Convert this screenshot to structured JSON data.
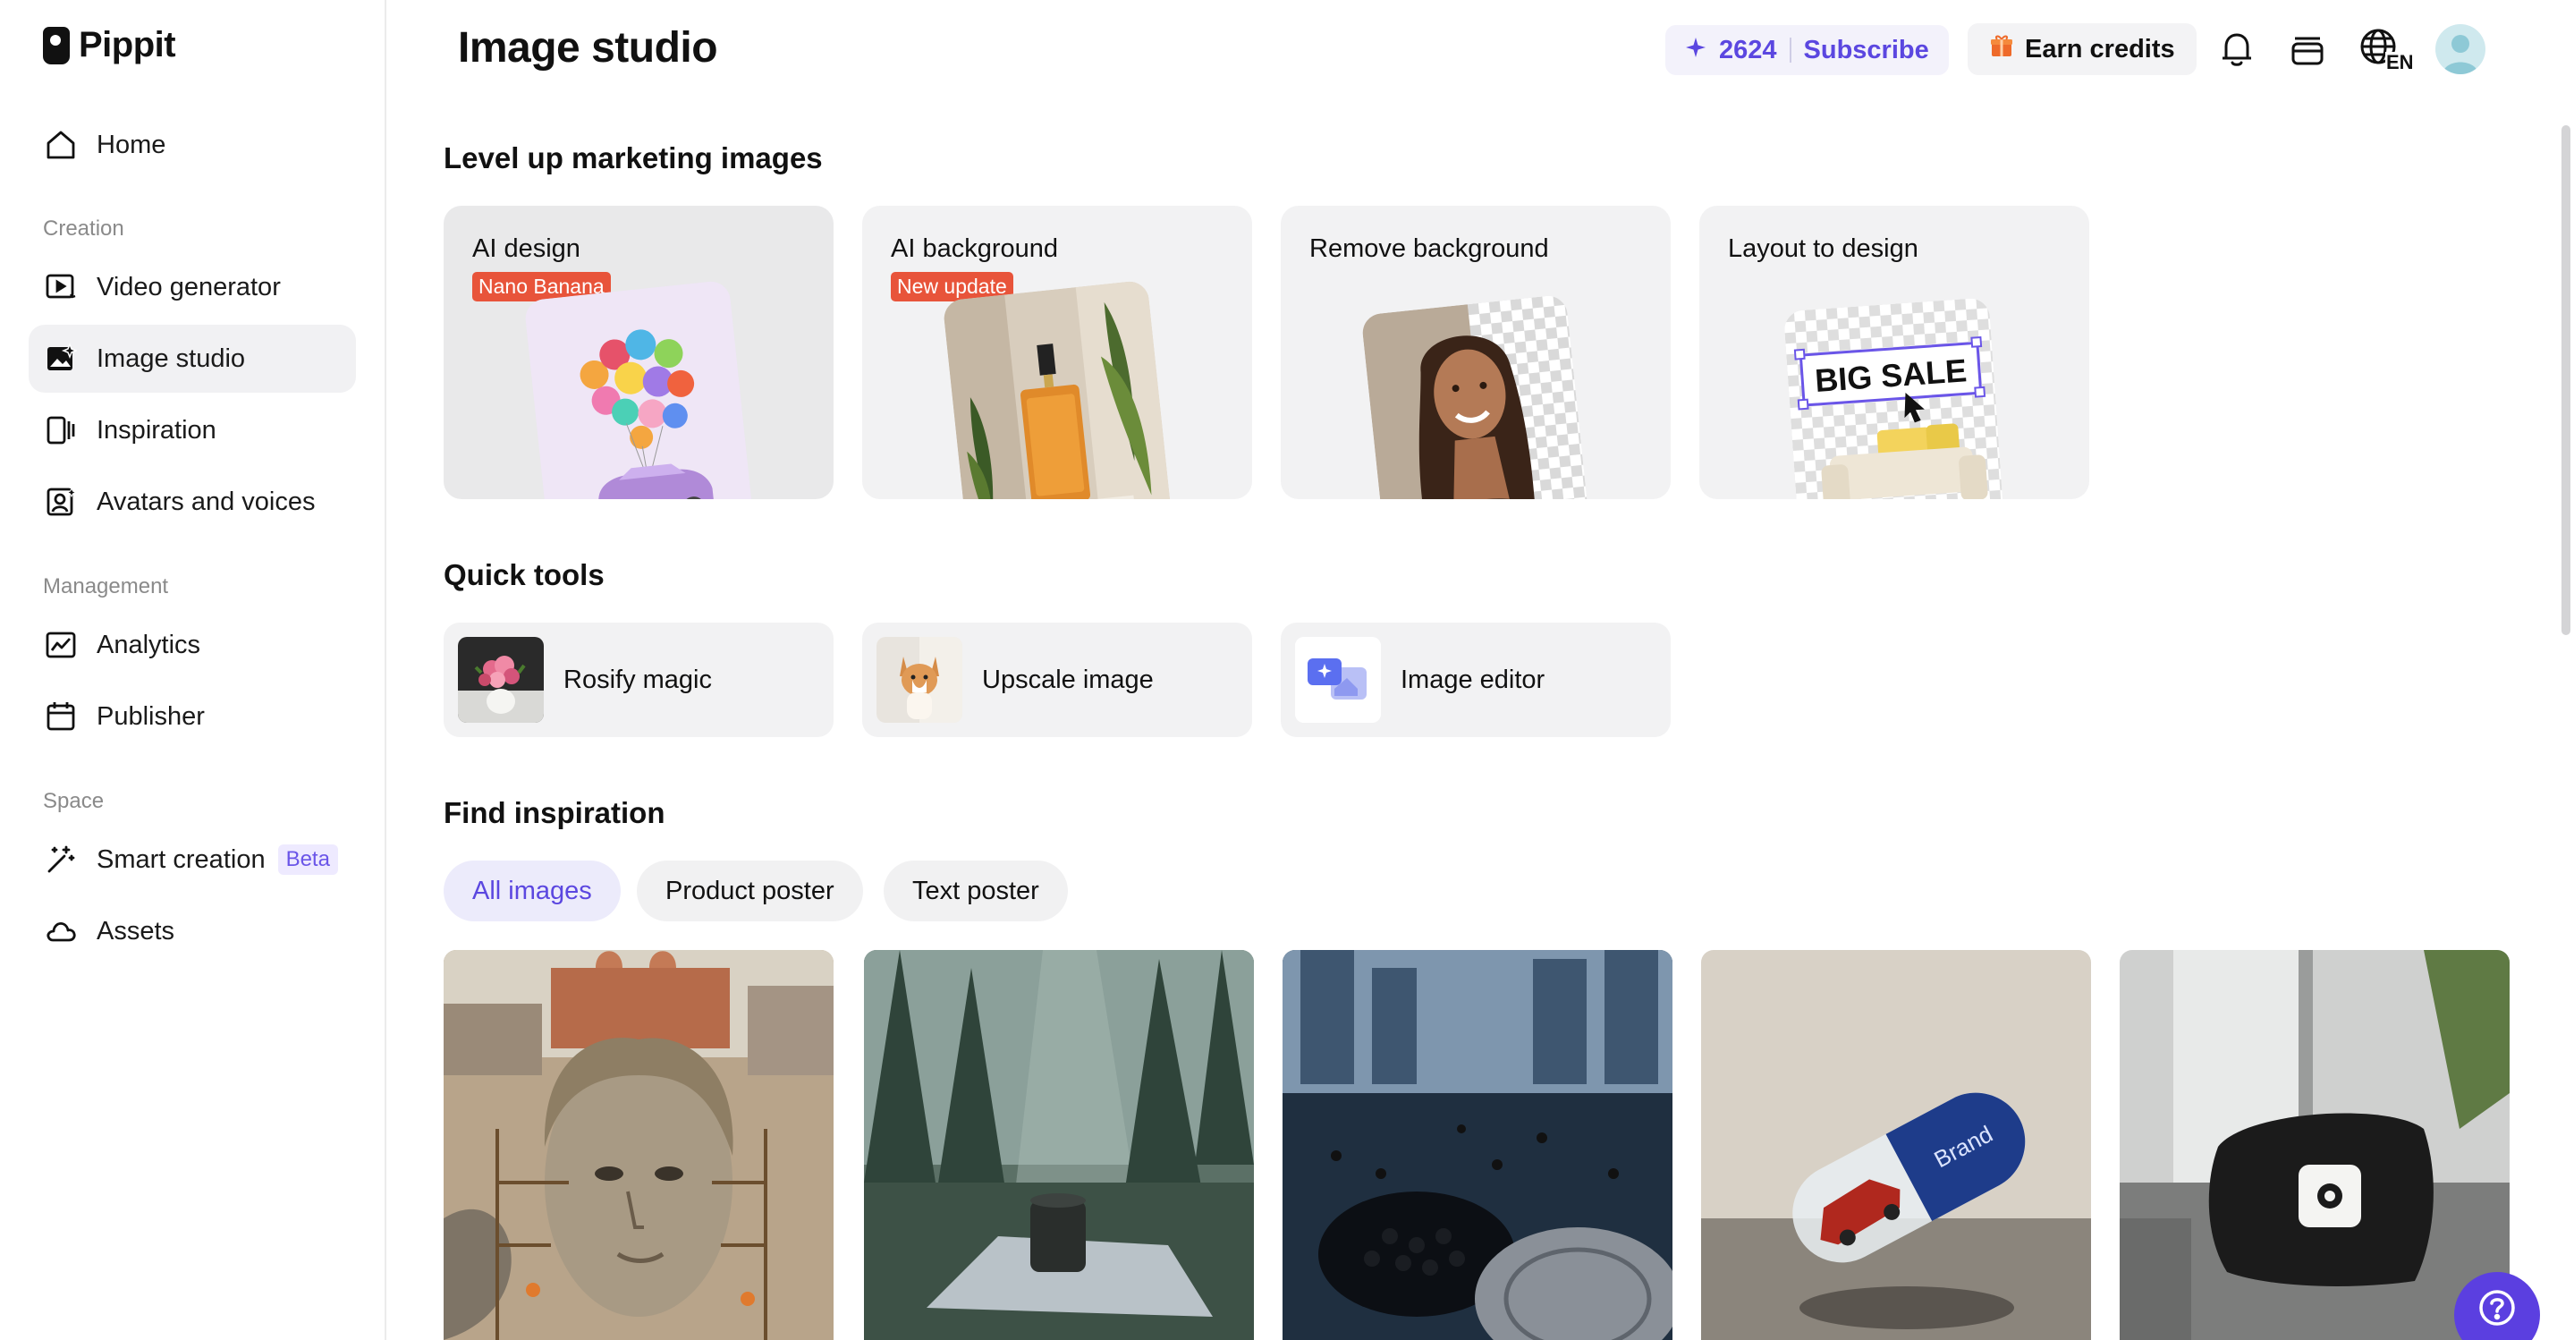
{
  "app": {
    "logo_text": "Pippit"
  },
  "sidebar": {
    "home": "Home",
    "sections": {
      "creation": "Creation",
      "management": "Management",
      "space": "Space"
    },
    "creation_items": [
      {
        "label": "Video generator",
        "icon": "video-play-icon"
      },
      {
        "label": "Image studio",
        "icon": "image-sparkle-icon",
        "active": true
      },
      {
        "label": "Inspiration",
        "icon": "inspiration-icon"
      },
      {
        "label": "Avatars and voices",
        "icon": "avatar-icon"
      }
    ],
    "management_items": [
      {
        "label": "Analytics",
        "icon": "chart-icon"
      },
      {
        "label": "Publisher",
        "icon": "calendar-icon"
      }
    ],
    "space_items": [
      {
        "label": "Smart creation",
        "icon": "magic-wand-icon",
        "badge": "Beta"
      },
      {
        "label": "Assets",
        "icon": "cloud-icon"
      }
    ]
  },
  "header": {
    "title": "Image studio",
    "credits": "2624",
    "subscribe": "Subscribe",
    "earn_credits": "Earn credits",
    "language": "EN"
  },
  "marketing": {
    "title": "Level up marketing images",
    "cards": [
      {
        "title": "AI design",
        "badge": "Nano Banana"
      },
      {
        "title": "AI background",
        "badge": "New update"
      },
      {
        "title": "Remove background"
      },
      {
        "title": "Layout to design",
        "art_text": "BIG SALE"
      }
    ]
  },
  "quick_tools": {
    "title": "Quick tools",
    "items": [
      {
        "label": "Rosify magic"
      },
      {
        "label": "Upscale image"
      },
      {
        "label": "Image editor"
      }
    ]
  },
  "inspiration": {
    "title": "Find inspiration",
    "filters": [
      {
        "label": "All images",
        "active": true
      },
      {
        "label": "Product poster"
      },
      {
        "label": "Text poster"
      }
    ],
    "gallery_capsule_text": "Brand"
  },
  "colors": {
    "accent": "#5b47e0",
    "badge_red": "#e8543a",
    "card_bg": "#f2f2f3"
  }
}
